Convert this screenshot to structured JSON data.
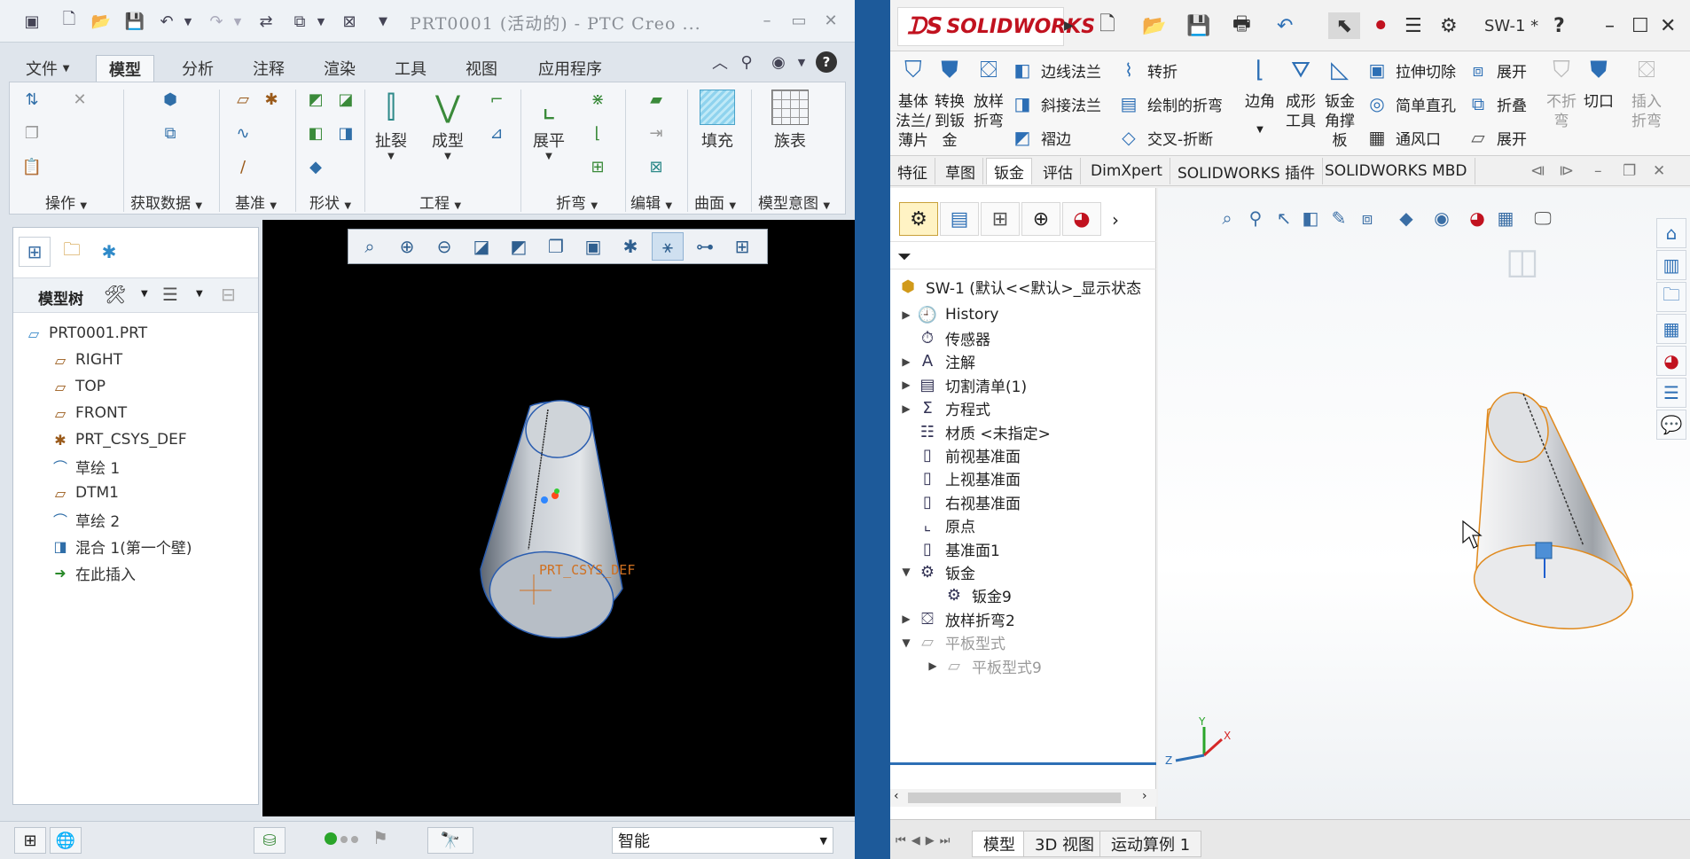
{
  "creo": {
    "title": "PRT0001 (活动的) - PTC Creo ...",
    "tabs": [
      "文件",
      "模型",
      "分析",
      "注释",
      "渲染",
      "工具",
      "视图",
      "应用程序"
    ],
    "active_tab": "模型",
    "ribbon_groups": [
      "操作",
      "获取数据",
      "基准",
      "形状",
      "工程",
      "折弯",
      "编辑",
      "曲面",
      "模型意图"
    ],
    "ribbon_buttons": {
      "rip": "扯裂",
      "form": "成型",
      "unbend": "展平",
      "fill": "填充",
      "family_table": "族表"
    },
    "model_tree_label": "模型树",
    "tree": [
      {
        "label": "PRT0001.PRT",
        "icon": "part-icon"
      },
      {
        "label": "RIGHT",
        "icon": "datum-plane-icon"
      },
      {
        "label": "TOP",
        "icon": "datum-plane-icon"
      },
      {
        "label": "FRONT",
        "icon": "datum-plane-icon"
      },
      {
        "label": "PRT_CSYS_DEF",
        "icon": "csys-icon"
      },
      {
        "label": "草绘 1",
        "icon": "sketch-icon"
      },
      {
        "label": "DTM1",
        "icon": "datum-plane-icon"
      },
      {
        "label": "草绘 2",
        "icon": "sketch-icon"
      },
      {
        "label": "混合 1(第一个壁)",
        "icon": "blend-wall-icon"
      },
      {
        "label": "在此插入",
        "icon": "insert-arrow-icon"
      }
    ],
    "canvas_label": "PRT_CSYS_DEF",
    "filter_value": "智能"
  },
  "sw": {
    "logo": "SOLIDWORKS",
    "doc_name": "SW-1 *",
    "help_label": "?",
    "commands_big": [
      {
        "label": "基体\n法兰/\n薄片"
      },
      {
        "label": "转换\n到钣\n金"
      },
      {
        "label": "放样\n折弯"
      },
      {
        "label": "边角"
      },
      {
        "label": "成形\n工具"
      },
      {
        "label": "钣金\n角撑\n板"
      },
      {
        "label": "不折\n弯"
      },
      {
        "label": "切口"
      },
      {
        "label": "插入\n折弯"
      }
    ],
    "commands_small": {
      "edge_flange": "边线法兰",
      "miter_flange": "斜接法兰",
      "hem": "褶边",
      "jog": "转折",
      "sketched_bend": "绘制的折弯",
      "cross_break": "交叉-折断",
      "extruded_cut": "拉伸切除",
      "simple_hole": "简单直孔",
      "vent": "通风口",
      "unfold": "展开",
      "fold": "折叠",
      "flatten": "展开"
    },
    "tabs": [
      "特征",
      "草图",
      "钣金",
      "评估",
      "DimXpert",
      "SOLIDWORKS 插件",
      "SOLIDWORKS MBD"
    ],
    "active_tab": "钣金",
    "root": "SW-1  (默认<<默认>_显示状态",
    "tree": [
      {
        "label": "History",
        "arrow": "▶",
        "indent": 0,
        "dim": false
      },
      {
        "label": "传感器",
        "arrow": "",
        "indent": 0,
        "dim": false
      },
      {
        "label": "注解",
        "arrow": "▶",
        "indent": 0,
        "dim": false
      },
      {
        "label": "切割清单(1)",
        "arrow": "▶",
        "indent": 0,
        "dim": false
      },
      {
        "label": "方程式",
        "arrow": "▶",
        "indent": 0,
        "dim": false
      },
      {
        "label": "材质 <未指定>",
        "arrow": "",
        "indent": 0,
        "dim": false
      },
      {
        "label": "前视基准面",
        "arrow": "",
        "indent": 0,
        "dim": false
      },
      {
        "label": "上视基准面",
        "arrow": "",
        "indent": 0,
        "dim": false
      },
      {
        "label": "右视基准面",
        "arrow": "",
        "indent": 0,
        "dim": false
      },
      {
        "label": "原点",
        "arrow": "",
        "indent": 0,
        "dim": false
      },
      {
        "label": "基准面1",
        "arrow": "",
        "indent": 0,
        "dim": false
      },
      {
        "label": "钣金",
        "arrow": "▼",
        "indent": 0,
        "dim": false
      },
      {
        "label": "钣金9",
        "arrow": "",
        "indent": 1,
        "dim": false
      },
      {
        "label": "放样折弯2",
        "arrow": "▶",
        "indent": 0,
        "dim": false
      },
      {
        "label": "平板型式",
        "arrow": "▼",
        "indent": 0,
        "dim": true
      },
      {
        "label": "平板型式9",
        "arrow": "▶",
        "indent": 1,
        "dim": true
      }
    ],
    "bottom_tabs": [
      "模型",
      "3D 视图",
      "运动算例 1"
    ],
    "active_bottom_tab": "模型",
    "triad": {
      "x": "X",
      "y": "Y",
      "z": "Z"
    }
  },
  "colors": {
    "desktop": "#1d5a9a",
    "sw_red": "#c1121f",
    "creo_canvas": "#000000",
    "selection_orange": "#e08a1e"
  }
}
